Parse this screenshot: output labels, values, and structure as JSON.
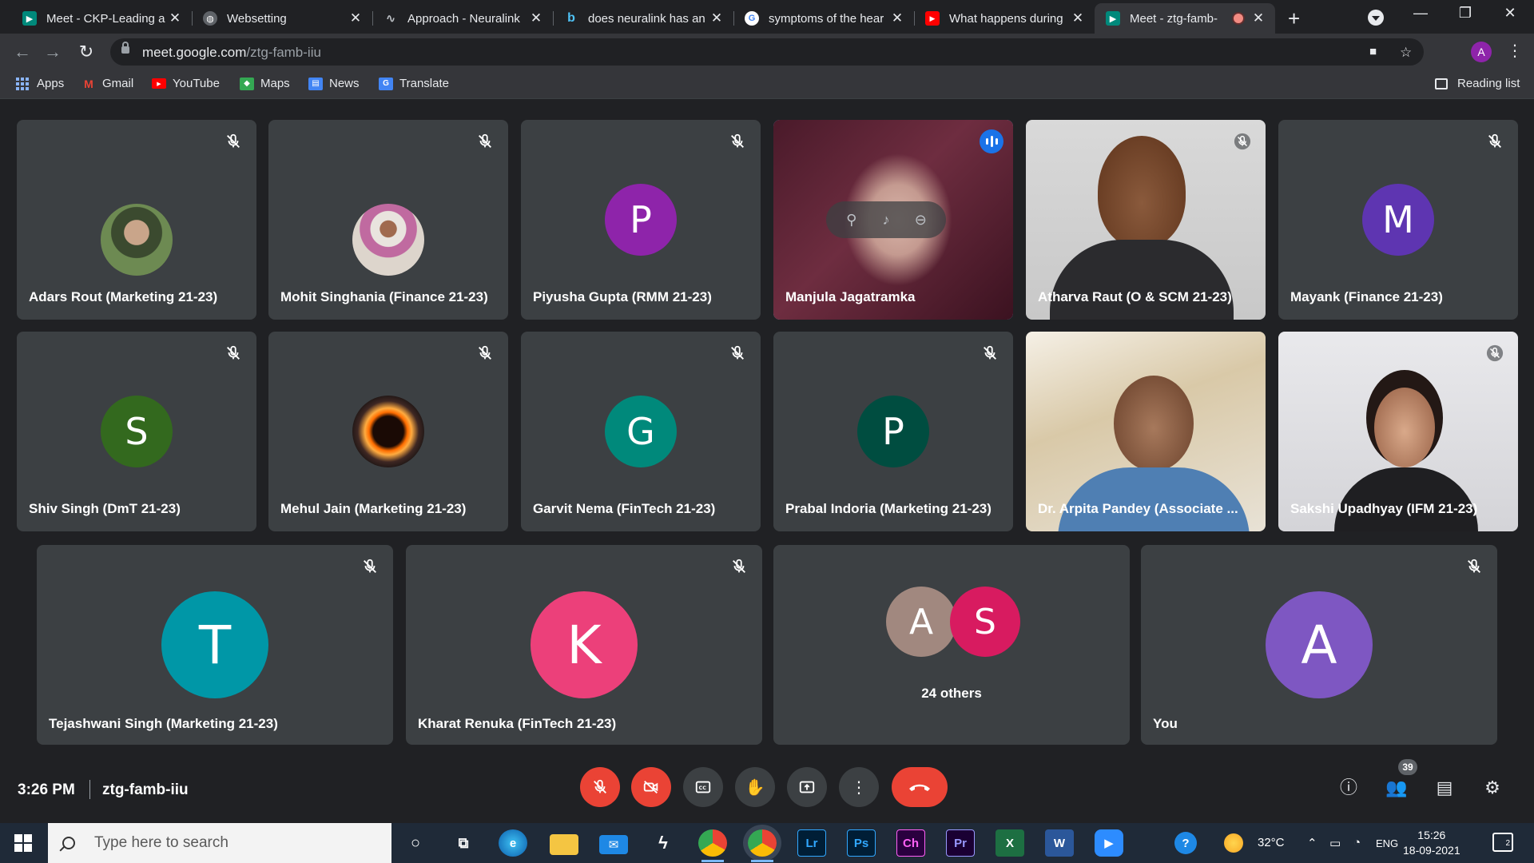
{
  "browser": {
    "tabs": [
      {
        "title": "Meet - CKP-Leading a",
        "favicon_color": "#00897b",
        "favicon_glyph": "▶"
      },
      {
        "title": "Websetting",
        "favicon_color": "#5f6368",
        "favicon_glyph": "◍"
      },
      {
        "title": "Approach - Neuralink",
        "favicon_color": "#5f6368",
        "favicon_glyph": "∿"
      },
      {
        "title": "does neuralink has an",
        "favicon_color": "#1a73e8",
        "favicon_glyph": "b"
      },
      {
        "title": "symptoms of the hear",
        "favicon_color": "#ffffff",
        "favicon_glyph": "G"
      },
      {
        "title": "What happens during",
        "favicon_color": "#ff0000",
        "favicon_glyph": "▶"
      },
      {
        "title": "Meet - ztg-famb-",
        "favicon_color": "#00897b",
        "favicon_glyph": "▶"
      }
    ],
    "url_host": "meet.google.com",
    "url_path": "/ztg-famb-iiu",
    "profile_initial": "A",
    "bookmarks": [
      "Apps",
      "Gmail",
      "YouTube",
      "Maps",
      "News",
      "Translate"
    ],
    "reading_list": "Reading list"
  },
  "meet": {
    "tiles": [
      {
        "name": "Adars Rout (Marketing 21-23)",
        "kind": "photo",
        "color": "#8d6e63",
        "muted": true
      },
      {
        "name": "Mohit Singhania (Finance 21-23)",
        "kind": "photo",
        "color": "#c7a48e",
        "muted": true
      },
      {
        "name": "Piyusha Gupta (RMM 21-23)",
        "kind": "letter",
        "letter": "P",
        "color": "#8e24aa",
        "muted": true
      },
      {
        "name": "Manjula Jagatramka",
        "kind": "video",
        "speaking": true
      },
      {
        "name": "Atharva Raut (O & SCM 21-23)",
        "kind": "video",
        "muted": true
      },
      {
        "name": "Mayank (Finance 21-23)",
        "kind": "letter",
        "letter": "M",
        "color": "#5e35b1",
        "muted": true
      },
      {
        "name": "Shiv Singh (DmT 21-23)",
        "kind": "letter",
        "letter": "S",
        "color": "#33691e",
        "muted": true
      },
      {
        "name": "Mehul Jain (Marketing 21-23)",
        "kind": "photo",
        "color": "#e65100",
        "muted": true
      },
      {
        "name": "Garvit Nema (FinTech 21-23)",
        "kind": "letter",
        "letter": "G",
        "color": "#00897b",
        "muted": true
      },
      {
        "name": "Prabal Indoria (Marketing 21-23)",
        "kind": "letter",
        "letter": "P",
        "color": "#004d40",
        "muted": true
      },
      {
        "name": "Dr. Arpita Pandey (Associate ...",
        "kind": "video",
        "muted": false
      },
      {
        "name": "Sakshi Upadhyay (IFM 21-23)",
        "kind": "video",
        "muted": true
      },
      {
        "name": "Tejashwani Singh (Marketing 21-23)",
        "kind": "letter",
        "letter": "T",
        "color": "#0097a7",
        "muted": true
      },
      {
        "name": "Kharat Renuka (FinTech 21-23)",
        "kind": "letter",
        "letter": "K",
        "color": "#ec407a",
        "muted": true
      },
      {
        "name": "",
        "kind": "others",
        "letters": [
          "A",
          "S"
        ],
        "colors": [
          "#a1887f",
          "#d81b60"
        ],
        "label": "24 others"
      },
      {
        "name": "You",
        "kind": "letter",
        "letter": "A",
        "color": "#7e57c2",
        "muted": true
      }
    ],
    "time": "3:26 PM",
    "meeting_code": "ztg-famb-iiu",
    "participant_count": "39"
  },
  "taskbar": {
    "search_placeholder": "Type here to search",
    "apps": [
      "Lr",
      "Ps",
      "Ch",
      "Pr",
      "X",
      "W"
    ],
    "temperature": "32°C",
    "language": "ENG",
    "clock_time": "15:26",
    "clock_date": "18-09-2021",
    "notifications": "2"
  },
  "colors": {
    "tile_bg": "#3c4043",
    "active_outline": "#8ab4f8",
    "hangup": "#ea4335"
  }
}
